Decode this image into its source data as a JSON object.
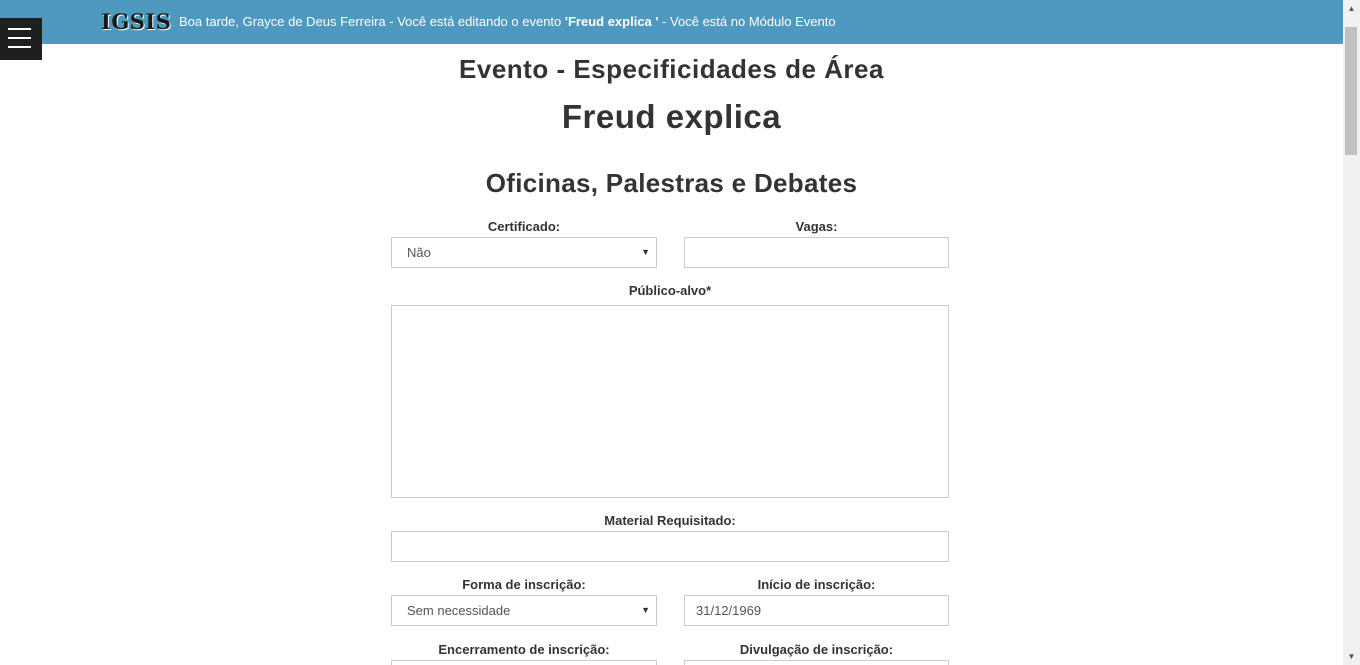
{
  "header": {
    "logo": "IGSIS",
    "greeting_prefix": "Boa tarde, Grayce de Deus Ferreira - Você está editando o evento ",
    "event_name": "'Freud explica '",
    "greeting_suffix": " - Você está no Módulo Evento",
    "bar_color": "#4d99bf"
  },
  "menu": {
    "icon": "hamburger-menu-icon"
  },
  "page": {
    "heading": "Evento - Especificidades de Área",
    "event_title": "Freud explica",
    "section_title": "Oficinas, Palestras e Debates"
  },
  "form": {
    "certificado": {
      "label": "Certificado:",
      "value": "Não"
    },
    "vagas": {
      "label": "Vagas:",
      "value": ""
    },
    "publico_alvo": {
      "label": "Público-alvo*",
      "value": ""
    },
    "material": {
      "label": "Material Requisitado:",
      "value": ""
    },
    "forma_inscricao": {
      "label": "Forma de inscrição:",
      "value": "Sem necessidade"
    },
    "inicio_inscricao": {
      "label": "Início de inscrição:",
      "value": "31/12/1969"
    },
    "encerramento_inscricao": {
      "label": "Encerramento de inscrição:",
      "value": ""
    },
    "divulgacao_inscricao": {
      "label": "Divulgação de inscrição:",
      "value": ""
    }
  },
  "scrollbar": {
    "up_icon": "scroll-up-arrow-icon",
    "down_icon": "scroll-down-arrow-icon"
  }
}
